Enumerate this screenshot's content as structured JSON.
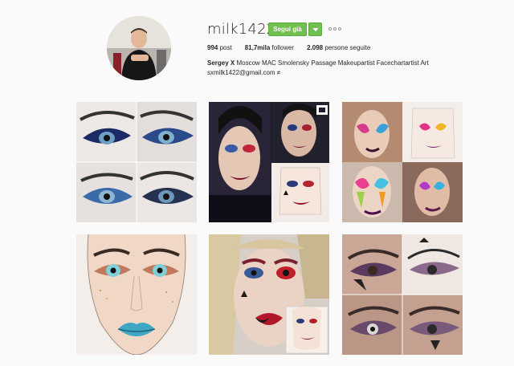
{
  "profile": {
    "username": "milk1422",
    "follow_label": "Segui già",
    "posts_count": "994",
    "posts_label": "post",
    "followers_count": "81,7mila",
    "followers_label": "follower",
    "following_count": "2.098",
    "following_label": "persone seguite",
    "bio_name": "Sergey X",
    "bio_text": "Moscow MAC Smolensky Passage Makeupartist Facechartartist Art",
    "bio_email": "sxmilk1422@gmail.com ≠"
  },
  "icons": {
    "dropdown": "chevron-down-icon",
    "more": "more-options-icon",
    "multi": "multiple-photos-icon"
  },
  "colors": {
    "follow_green": "#70c050",
    "background": "#fafafa"
  }
}
